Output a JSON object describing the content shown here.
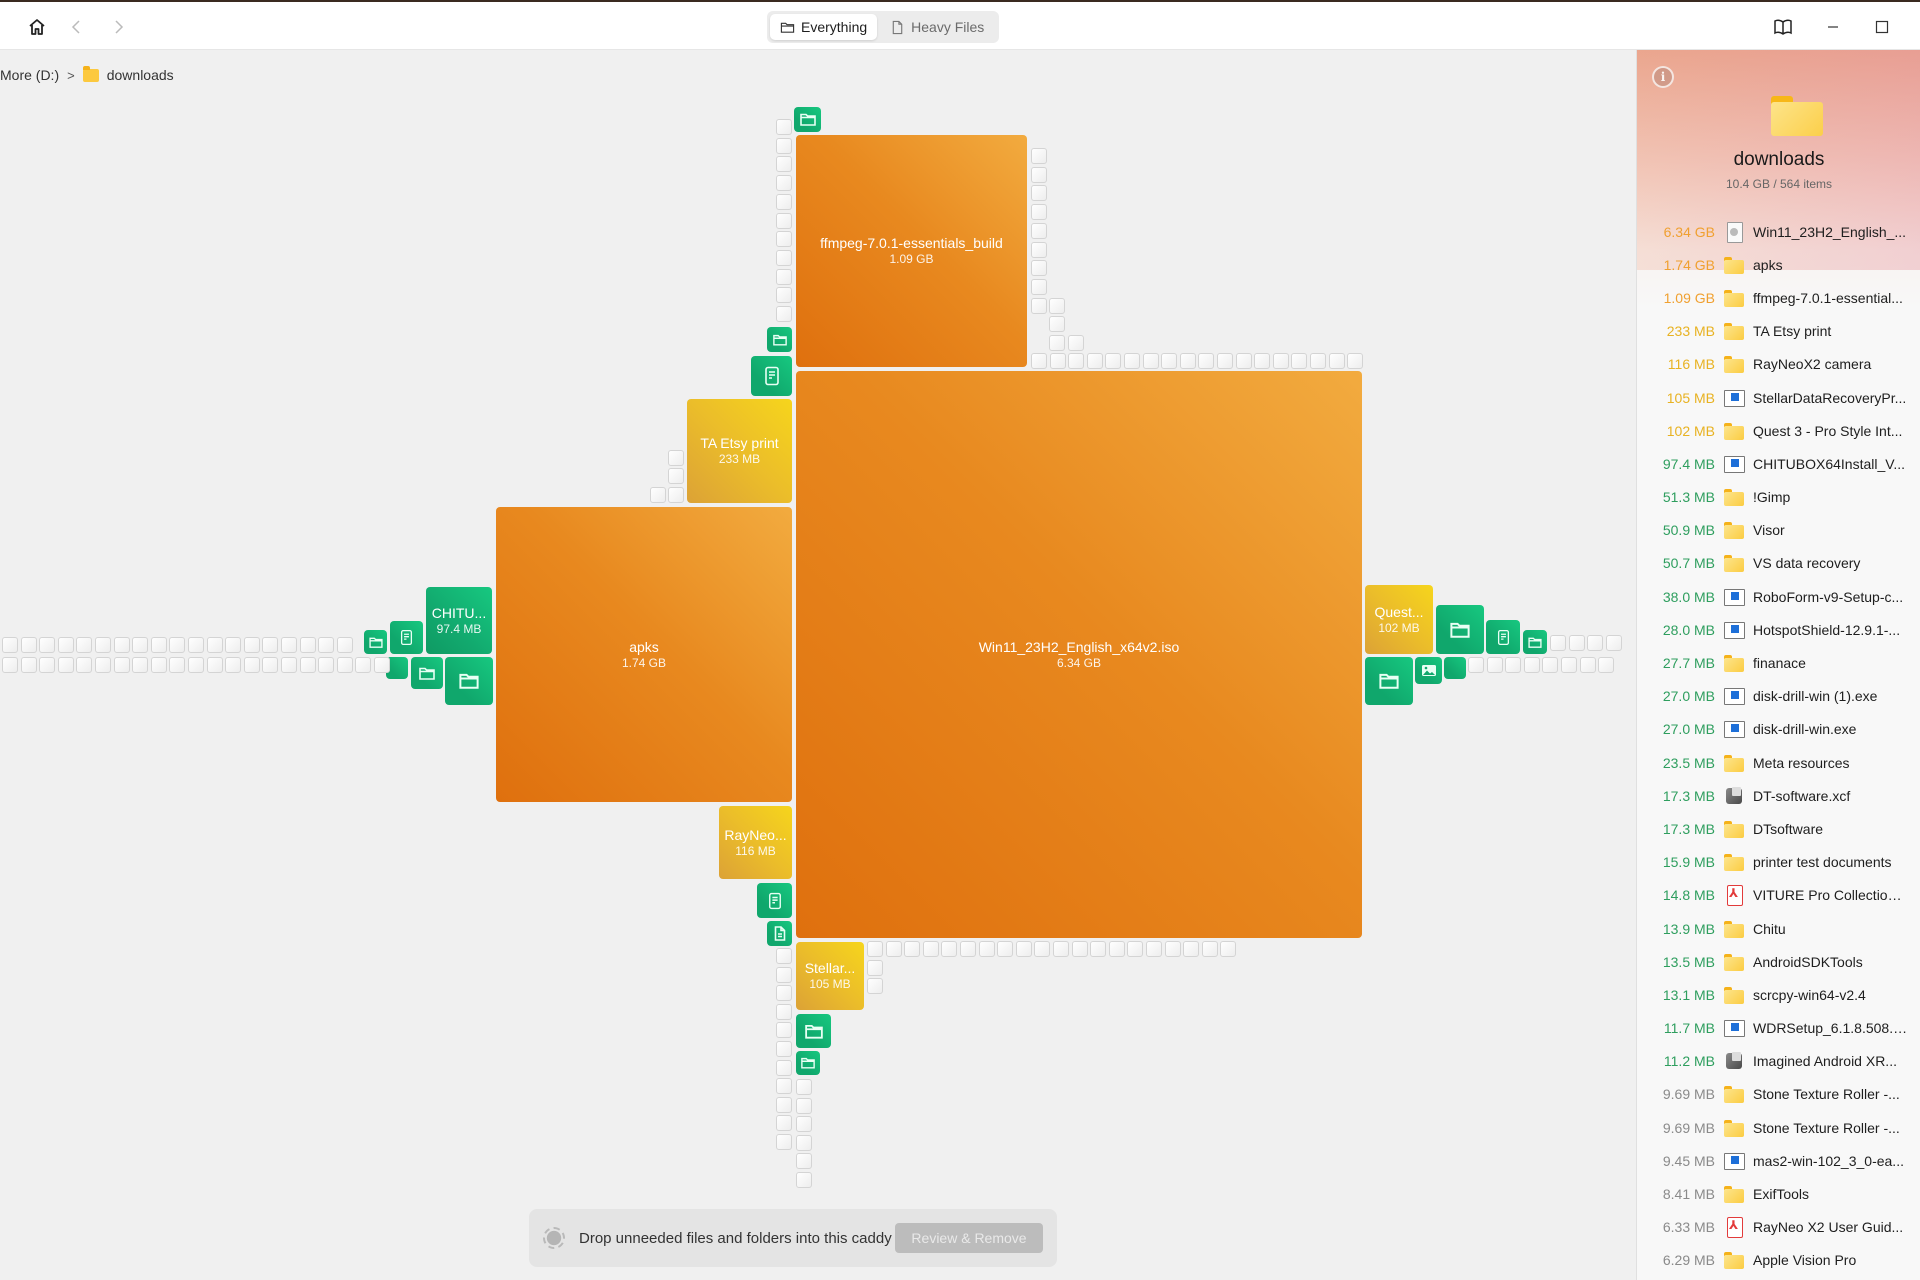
{
  "titlebar": {
    "home_icon": "home-icon",
    "back_icon": "chevron-left-icon",
    "forward_icon": "chevron-right-icon",
    "tabs": [
      {
        "label": "Everything",
        "icon": "folder-icon",
        "active": true
      },
      {
        "label": "Heavy Files",
        "icon": "file-icon",
        "active": false
      }
    ],
    "right_icons": [
      "book-icon",
      "minimize-icon",
      "maximize-icon"
    ]
  },
  "breadcrumb": {
    "root": "More (D:)",
    "separator": ">",
    "current": "downloads"
  },
  "treemap": {
    "blocks": [
      {
        "id": "win11",
        "name": "Win11_23H2_English_x64v2.iso",
        "size": "6.34 GB",
        "color": "orange"
      },
      {
        "id": "apks",
        "name": "apks",
        "size": "1.74 GB",
        "color": "orange"
      },
      {
        "id": "ffmpeg",
        "name": "ffmpeg-7.0.1-essentials_build",
        "size": "1.09 GB",
        "color": "orange"
      },
      {
        "id": "taetsy",
        "name": "TA Etsy print",
        "size": "233 MB",
        "color": "yellow"
      },
      {
        "id": "rayneo",
        "name": "RayNeo...",
        "size": "116 MB",
        "color": "yellow"
      },
      {
        "id": "stellar",
        "name": "Stellar...",
        "size": "105 MB",
        "color": "yellow"
      },
      {
        "id": "quest",
        "name": "Quest...",
        "size": "102 MB",
        "color": "yellow"
      },
      {
        "id": "chitu",
        "name": "CHITU...",
        "size": "97.4 MB",
        "color": "green"
      }
    ],
    "colors": {
      "orange": "#e8891f",
      "yellow": "#ebbd2a",
      "green": "#12a96e",
      "tiny": "#f5f5f5"
    }
  },
  "caddy": {
    "text": "Drop unneeded files and folders into this caddy",
    "button": "Review & Remove"
  },
  "sidebar": {
    "info_icon": "info-icon",
    "title": "downloads",
    "subtitle": "10.4 GB / 564 items",
    "size_colors": {
      "orange": "#f0a030",
      "yellowish": "#e8b222",
      "green": "#2e9e5e",
      "gray": "#8a8a8a"
    },
    "items": [
      {
        "size": "6.34 GB",
        "name": "Win11_23H2_English_...",
        "type": "iso",
        "tone": "orange",
        "expandable": false
      },
      {
        "size": "1.74 GB",
        "name": "apks",
        "type": "folder",
        "tone": "orange",
        "expandable": true
      },
      {
        "size": "1.09 GB",
        "name": "ffmpeg-7.0.1-essential...",
        "type": "folder",
        "tone": "orange",
        "expandable": true
      },
      {
        "size": "233 MB",
        "name": "TA Etsy print",
        "type": "folder",
        "tone": "yellowish",
        "expandable": true
      },
      {
        "size": "116 MB",
        "name": "RayNeoX2 camera",
        "type": "folder",
        "tone": "yellowish",
        "expandable": true
      },
      {
        "size": "105 MB",
        "name": "StellarDataRecoveryPr...",
        "type": "exe",
        "tone": "yellowish",
        "expandable": false
      },
      {
        "size": "102 MB",
        "name": "Quest 3 - Pro Style Int...",
        "type": "folder",
        "tone": "yellowish",
        "expandable": true
      },
      {
        "size": "97.4 MB",
        "name": "CHITUBOX64Install_V...",
        "type": "exe",
        "tone": "green",
        "expandable": false
      },
      {
        "size": "51.3 MB",
        "name": "!Gimp",
        "type": "folder",
        "tone": "green",
        "expandable": true
      },
      {
        "size": "50.9 MB",
        "name": "Visor",
        "type": "folder",
        "tone": "green",
        "expandable": true
      },
      {
        "size": "50.7 MB",
        "name": "VS data recovery",
        "type": "folder",
        "tone": "green",
        "expandable": true
      },
      {
        "size": "38.0 MB",
        "name": "RoboForm-v9-Setup-c...",
        "type": "exe",
        "tone": "green",
        "expandable": false
      },
      {
        "size": "28.0 MB",
        "name": "HotspotShield-12.9.1-...",
        "type": "exe",
        "tone": "green",
        "expandable": false
      },
      {
        "size": "27.7 MB",
        "name": "finanace",
        "type": "folder",
        "tone": "green",
        "expandable": true
      },
      {
        "size": "27.0 MB",
        "name": "disk-drill-win (1).exe",
        "type": "exe",
        "tone": "green",
        "expandable": false
      },
      {
        "size": "27.0 MB",
        "name": "disk-drill-win.exe",
        "type": "exe",
        "tone": "green",
        "expandable": false
      },
      {
        "size": "23.5 MB",
        "name": "Meta resources",
        "type": "folder",
        "tone": "green",
        "expandable": true
      },
      {
        "size": "17.3 MB",
        "name": "DT-software.xcf",
        "type": "xcf",
        "tone": "green",
        "expandable": false
      },
      {
        "size": "17.3 MB",
        "name": "DTsoftware",
        "type": "folder",
        "tone": "green",
        "expandable": true
      },
      {
        "size": "15.9 MB",
        "name": "printer test documents",
        "type": "folder",
        "tone": "green",
        "expandable": true
      },
      {
        "size": "14.8 MB",
        "name": "VITURE Pro Collection....",
        "type": "pdf",
        "tone": "green",
        "expandable": false
      },
      {
        "size": "13.9 MB",
        "name": "Chitu",
        "type": "folder",
        "tone": "green",
        "expandable": true
      },
      {
        "size": "13.5 MB",
        "name": "AndroidSDKTools",
        "type": "folder",
        "tone": "green",
        "expandable": true
      },
      {
        "size": "13.1 MB",
        "name": "scrcpy-win64-v2.4",
        "type": "folder",
        "tone": "green",
        "expandable": true
      },
      {
        "size": "11.7 MB",
        "name": "WDRSetup_6.1.8.508.e...",
        "type": "exe",
        "tone": "green",
        "expandable": false
      },
      {
        "size": "11.2 MB",
        "name": "Imagined Android XR...",
        "type": "xcf",
        "tone": "green",
        "expandable": false
      },
      {
        "size": "9.69 MB",
        "name": "Stone Texture Roller -...",
        "type": "folder",
        "tone": "gray",
        "expandable": true
      },
      {
        "size": "9.69 MB",
        "name": "Stone Texture Roller -...",
        "type": "folder",
        "tone": "gray",
        "expandable": true
      },
      {
        "size": "9.45 MB",
        "name": "mas2-win-102_3_0-ea...",
        "type": "exe",
        "tone": "gray",
        "expandable": false
      },
      {
        "size": "8.41 MB",
        "name": "ExifTools",
        "type": "folder",
        "tone": "gray",
        "expandable": true
      },
      {
        "size": "6.33 MB",
        "name": "RayNeo X2 User Guid...",
        "type": "pdf",
        "tone": "gray",
        "expandable": false
      },
      {
        "size": "6.29 MB",
        "name": "Apple Vision Pro",
        "type": "folder",
        "tone": "gray",
        "expandable": true
      }
    ]
  }
}
